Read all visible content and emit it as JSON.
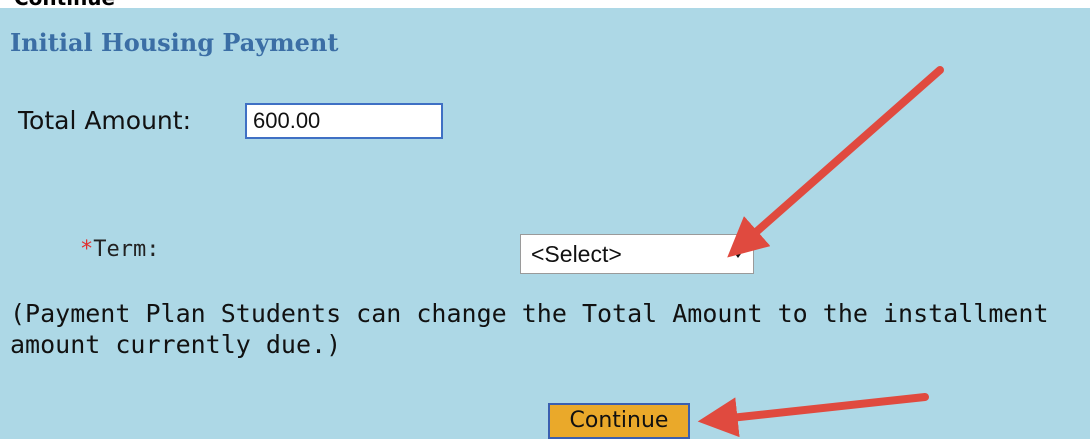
{
  "page": {
    "cut_off_text": "Continue",
    "heading": "Initial Housing Payment"
  },
  "form": {
    "total_amount_label": "Total Amount:",
    "total_amount_value": "600.00",
    "term_required_marker": "*",
    "term_label": "Term:",
    "term_selected": "<Select>",
    "note": "(Payment Plan Students can change the Total Amount to the installment amount currently due.)",
    "continue_label": "Continue"
  },
  "colors": {
    "panel_background": "#add8e6",
    "heading": "#3b6ea5",
    "button": "#eaa92a",
    "annotation_arrow": "#e04a3f"
  },
  "annotations": [
    {
      "type": "arrow",
      "points_to": "term-select"
    },
    {
      "type": "arrow",
      "points_to": "continue-button"
    }
  ]
}
